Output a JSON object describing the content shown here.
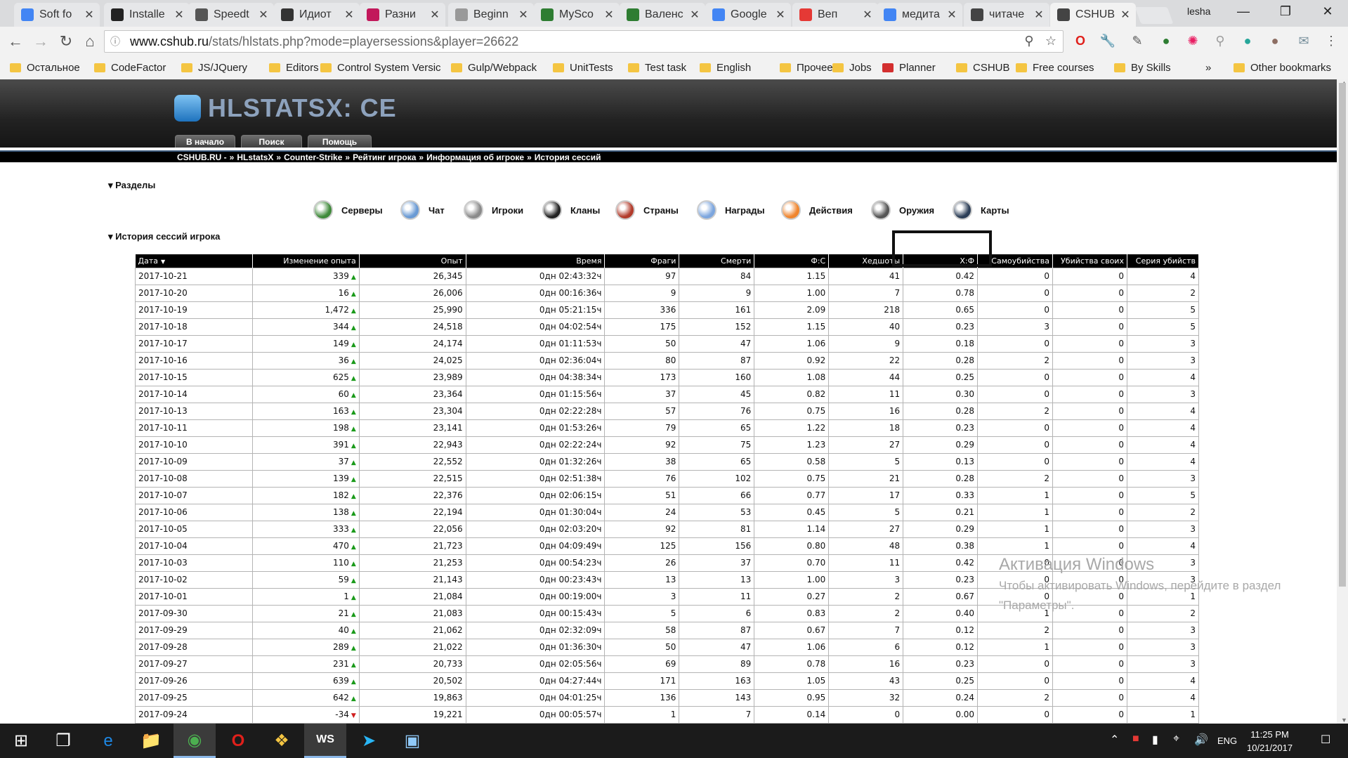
{
  "browser": {
    "tabs": [
      {
        "label": "Soft fo",
        "icon": "docs-icon",
        "color": "#4285f4"
      },
      {
        "label": "Installe",
        "icon": "github-icon",
        "color": "#222222"
      },
      {
        "label": "Speedt",
        "icon": "speedometer-icon",
        "color": "#555555"
      },
      {
        "label": "Идиот",
        "icon": "stackoverflow-icon",
        "color": "#333333"
      },
      {
        "label": "Разни",
        "icon": "heart-icon",
        "color": "#c2185b"
      },
      {
        "label": "Beginn",
        "icon": "page-icon",
        "color": "#999999"
      },
      {
        "label": "MySco",
        "icon": "myscore-icon",
        "color": "#2e7d32"
      },
      {
        "label": "Валенс",
        "icon": "myscore-icon",
        "color": "#2e7d32"
      },
      {
        "label": "Google",
        "icon": "translate-icon",
        "color": "#4285f4"
      },
      {
        "label": "Веп",
        "icon": "youtube-icon",
        "color": "#e53935"
      },
      {
        "label": "медита",
        "icon": "google-icon",
        "color": "#4285f4"
      },
      {
        "label": "читаче",
        "icon": "hlstats-icon",
        "color": "#444444"
      },
      {
        "label": "CSHUB",
        "icon": "hlstats-icon",
        "color": "#444444"
      }
    ],
    "user": "lesha",
    "url_host": "www.cshub.ru",
    "url_path": "/stats/hlstats.php?mode=playersessions&player=26622",
    "bookmarks": [
      "Остальное",
      "CodeFactor",
      "JS/JQuery",
      "Editors",
      "Control System Versic",
      "Gulp/Webpack",
      "UnitTests",
      "Test task",
      "English",
      "Прочее",
      "Jobs",
      "Planner",
      "CSHUB",
      "Free courses",
      "By Skills",
      "»",
      "Other bookmarks"
    ]
  },
  "site": {
    "logo": "HLSTATSX: CE",
    "buttons": [
      "В начало",
      "Поиск",
      "Помощь"
    ],
    "breadcrumb": [
      "CSHUB.RU -",
      "»",
      "HLstatsX",
      "»",
      "Counter-Strike",
      "»",
      "Рейтинг игрока",
      "»",
      "Информация об игроке",
      "»",
      "История сессий"
    ],
    "section_title": "Разделы",
    "nav": [
      {
        "label": "Серверы",
        "color": "#3f8a3a"
      },
      {
        "label": "Чат",
        "color": "#6a9ad4"
      },
      {
        "label": "Игроки",
        "color": "#8a8a8a"
      },
      {
        "label": "Кланы",
        "color": "#222222"
      },
      {
        "label": "Страны",
        "color": "#b23b2b"
      },
      {
        "label": "Награды",
        "color": "#7da6de"
      },
      {
        "label": "Действия",
        "color": "#f0852d"
      },
      {
        "label": "Оружия",
        "color": "#555555"
      },
      {
        "label": "Карты",
        "color": "#2c3e57"
      }
    ],
    "history_title": "История сессий игрока"
  },
  "table": {
    "headers": [
      "Дата",
      "Изменение опыта",
      "Опыт",
      "Время",
      "Фраги",
      "Смерти",
      "Ф:С",
      "Хедшоты",
      "Х:Ф",
      "Самоубийства",
      "Убийства своих",
      "Серия убийств"
    ],
    "sort_marker": "▼",
    "rows": [
      [
        "2017-10-21",
        "339",
        "up",
        "26,345",
        "0дн 02:43:32ч",
        "97",
        "84",
        "1.15",
        "41",
        "0.42",
        "0",
        "0",
        "4"
      ],
      [
        "2017-10-20",
        "16",
        "up",
        "26,006",
        "0дн 00:16:36ч",
        "9",
        "9",
        "1.00",
        "7",
        "0.78",
        "0",
        "0",
        "2"
      ],
      [
        "2017-10-19",
        "1,472",
        "up",
        "25,990",
        "0дн 05:21:15ч",
        "336",
        "161",
        "2.09",
        "218",
        "0.65",
        "0",
        "0",
        "5"
      ],
      [
        "2017-10-18",
        "344",
        "up",
        "24,518",
        "0дн 04:02:54ч",
        "175",
        "152",
        "1.15",
        "40",
        "0.23",
        "3",
        "0",
        "5"
      ],
      [
        "2017-10-17",
        "149",
        "up",
        "24,174",
        "0дн 01:11:53ч",
        "50",
        "47",
        "1.06",
        "9",
        "0.18",
        "0",
        "0",
        "3"
      ],
      [
        "2017-10-16",
        "36",
        "up",
        "24,025",
        "0дн 02:36:04ч",
        "80",
        "87",
        "0.92",
        "22",
        "0.28",
        "2",
        "0",
        "3"
      ],
      [
        "2017-10-15",
        "625",
        "up",
        "23,989",
        "0дн 04:38:34ч",
        "173",
        "160",
        "1.08",
        "44",
        "0.25",
        "0",
        "0",
        "4"
      ],
      [
        "2017-10-14",
        "60",
        "up",
        "23,364",
        "0дн 01:15:56ч",
        "37",
        "45",
        "0.82",
        "11",
        "0.30",
        "0",
        "0",
        "3"
      ],
      [
        "2017-10-13",
        "163",
        "up",
        "23,304",
        "0дн 02:22:28ч",
        "57",
        "76",
        "0.75",
        "16",
        "0.28",
        "2",
        "0",
        "4"
      ],
      [
        "2017-10-11",
        "198",
        "up",
        "23,141",
        "0дн 01:53:26ч",
        "79",
        "65",
        "1.22",
        "18",
        "0.23",
        "0",
        "0",
        "4"
      ],
      [
        "2017-10-10",
        "391",
        "up",
        "22,943",
        "0дн 02:22:24ч",
        "92",
        "75",
        "1.23",
        "27",
        "0.29",
        "0",
        "0",
        "4"
      ],
      [
        "2017-10-09",
        "37",
        "up",
        "22,552",
        "0дн 01:32:26ч",
        "38",
        "65",
        "0.58",
        "5",
        "0.13",
        "0",
        "0",
        "4"
      ],
      [
        "2017-10-08",
        "139",
        "up",
        "22,515",
        "0дн 02:51:38ч",
        "76",
        "102",
        "0.75",
        "21",
        "0.28",
        "2",
        "0",
        "3"
      ],
      [
        "2017-10-07",
        "182",
        "up",
        "22,376",
        "0дн 02:06:15ч",
        "51",
        "66",
        "0.77",
        "17",
        "0.33",
        "1",
        "0",
        "5"
      ],
      [
        "2017-10-06",
        "138",
        "up",
        "22,194",
        "0дн 01:30:04ч",
        "24",
        "53",
        "0.45",
        "5",
        "0.21",
        "1",
        "0",
        "2"
      ],
      [
        "2017-10-05",
        "333",
        "up",
        "22,056",
        "0дн 02:03:20ч",
        "92",
        "81",
        "1.14",
        "27",
        "0.29",
        "1",
        "0",
        "3"
      ],
      [
        "2017-10-04",
        "470",
        "up",
        "21,723",
        "0дн 04:09:49ч",
        "125",
        "156",
        "0.80",
        "48",
        "0.38",
        "1",
        "0",
        "4"
      ],
      [
        "2017-10-03",
        "110",
        "up",
        "21,253",
        "0дн 00:54:23ч",
        "26",
        "37",
        "0.70",
        "11",
        "0.42",
        "0",
        "0",
        "3"
      ],
      [
        "2017-10-02",
        "59",
        "up",
        "21,143",
        "0дн 00:23:43ч",
        "13",
        "13",
        "1.00",
        "3",
        "0.23",
        "0",
        "0",
        "3"
      ],
      [
        "2017-10-01",
        "1",
        "up",
        "21,084",
        "0дн 00:19:00ч",
        "3",
        "11",
        "0.27",
        "2",
        "0.67",
        "0",
        "0",
        "1"
      ],
      [
        "2017-09-30",
        "21",
        "up",
        "21,083",
        "0дн 00:15:43ч",
        "5",
        "6",
        "0.83",
        "2",
        "0.40",
        "1",
        "0",
        "2"
      ],
      [
        "2017-09-29",
        "40",
        "up",
        "21,062",
        "0дн 02:32:09ч",
        "58",
        "87",
        "0.67",
        "7",
        "0.12",
        "2",
        "0",
        "3"
      ],
      [
        "2017-09-28",
        "289",
        "up",
        "21,022",
        "0дн 01:36:30ч",
        "50",
        "47",
        "1.06",
        "6",
        "0.12",
        "1",
        "0",
        "3"
      ],
      [
        "2017-09-27",
        "231",
        "up",
        "20,733",
        "0дн 02:05:56ч",
        "69",
        "89",
        "0.78",
        "16",
        "0.23",
        "0",
        "0",
        "3"
      ],
      [
        "2017-09-26",
        "639",
        "up",
        "20,502",
        "0дн 04:27:44ч",
        "171",
        "163",
        "1.05",
        "43",
        "0.25",
        "0",
        "0",
        "4"
      ],
      [
        "2017-09-25",
        "642",
        "up",
        "19,863",
        "0дн 04:01:25ч",
        "136",
        "143",
        "0.95",
        "32",
        "0.24",
        "2",
        "0",
        "4"
      ],
      [
        "2017-09-24",
        "-34",
        "down",
        "19,221",
        "0дн 00:05:57ч",
        "1",
        "7",
        "0.14",
        "0",
        "0.00",
        "0",
        "0",
        "1"
      ]
    ]
  },
  "watermark": {
    "title": "Активация Windows",
    "line1": "Чтобы активировать Windows, перейдите в раздел",
    "line2": "\"Параметры\"."
  },
  "taskbar": {
    "lang": "ENG",
    "time": "11:25 PM",
    "date": "10/21/2017"
  }
}
